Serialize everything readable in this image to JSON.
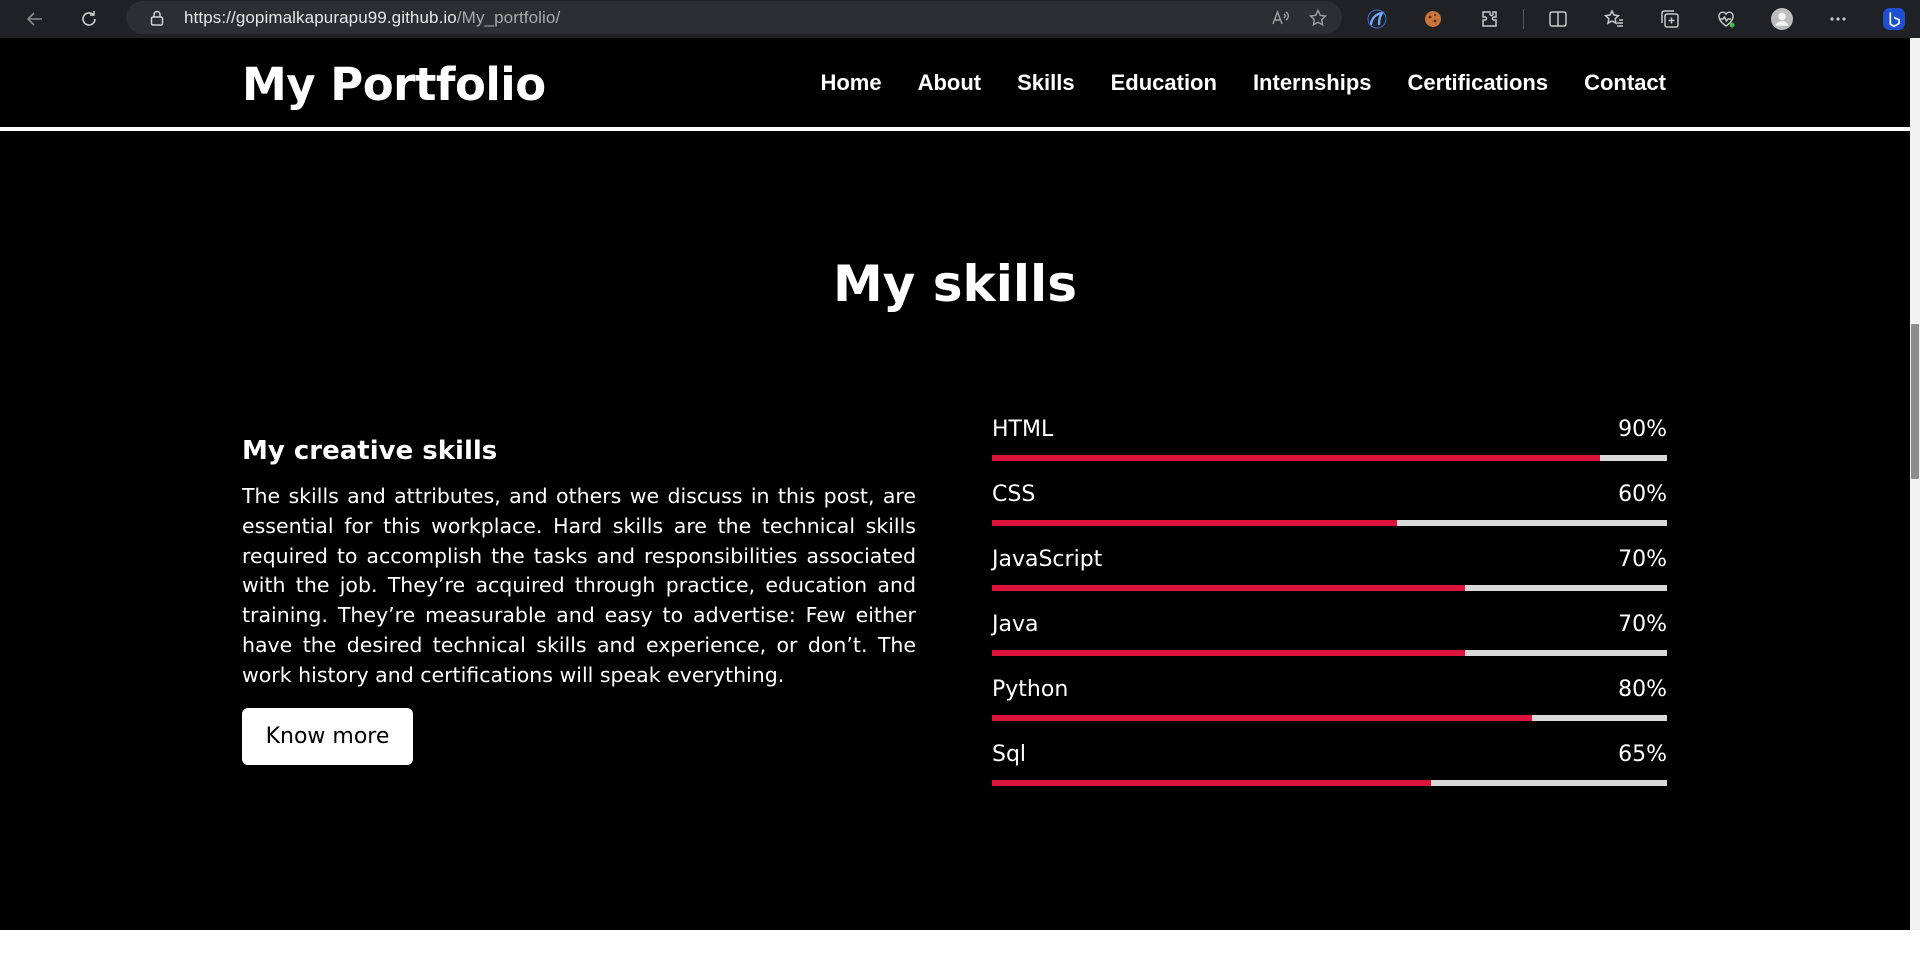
{
  "browser": {
    "url_host": "https://gopimalkapurapu99.github.io",
    "url_path": "/My_portfolio/"
  },
  "site": {
    "logo": "My Portfolio",
    "nav": [
      "Home",
      "About",
      "Skills",
      "Education",
      "Internships",
      "Certifications",
      "Contact"
    ]
  },
  "skills_section": {
    "title": "My skills",
    "heading": "My creative skills",
    "description": "The skills and attributes, and others we discuss in this post, are essential for this workplace. Hard skills are the technical skills required to accomplish the tasks and responsibilities associated with the job. They’re acquired through practice, education and training. They’re measurable and easy to advertise: Few either have the desired technical skills and experience, or don’t. The work history and certifications will speak everything.",
    "button_label": "Know more",
    "skills": [
      {
        "name": "HTML",
        "percent_label": "90%",
        "level": 90
      },
      {
        "name": "CSS",
        "percent_label": "60%",
        "level": 60
      },
      {
        "name": "JavaScript",
        "percent_label": "70%",
        "level": 70
      },
      {
        "name": "Java",
        "percent_label": "70%",
        "level": 70
      },
      {
        "name": "Python",
        "percent_label": "80%",
        "level": 80
      },
      {
        "name": "Sql",
        "percent_label": "65%",
        "level": 65
      }
    ]
  },
  "colors": {
    "bar_fill": "#dc143c",
    "bar_track": "#d9d9d9",
    "page_background": "#000000"
  },
  "icons": [
    "back-arrow-icon",
    "refresh-icon",
    "lock-icon",
    "read-aloud-icon",
    "favorite-star-icon",
    "extension-icon",
    "split-screen-icon",
    "favorites-icon",
    "collections-icon",
    "performance-icon",
    "profile-icon",
    "more-menu-icon",
    "bing-copilot-icon"
  ]
}
